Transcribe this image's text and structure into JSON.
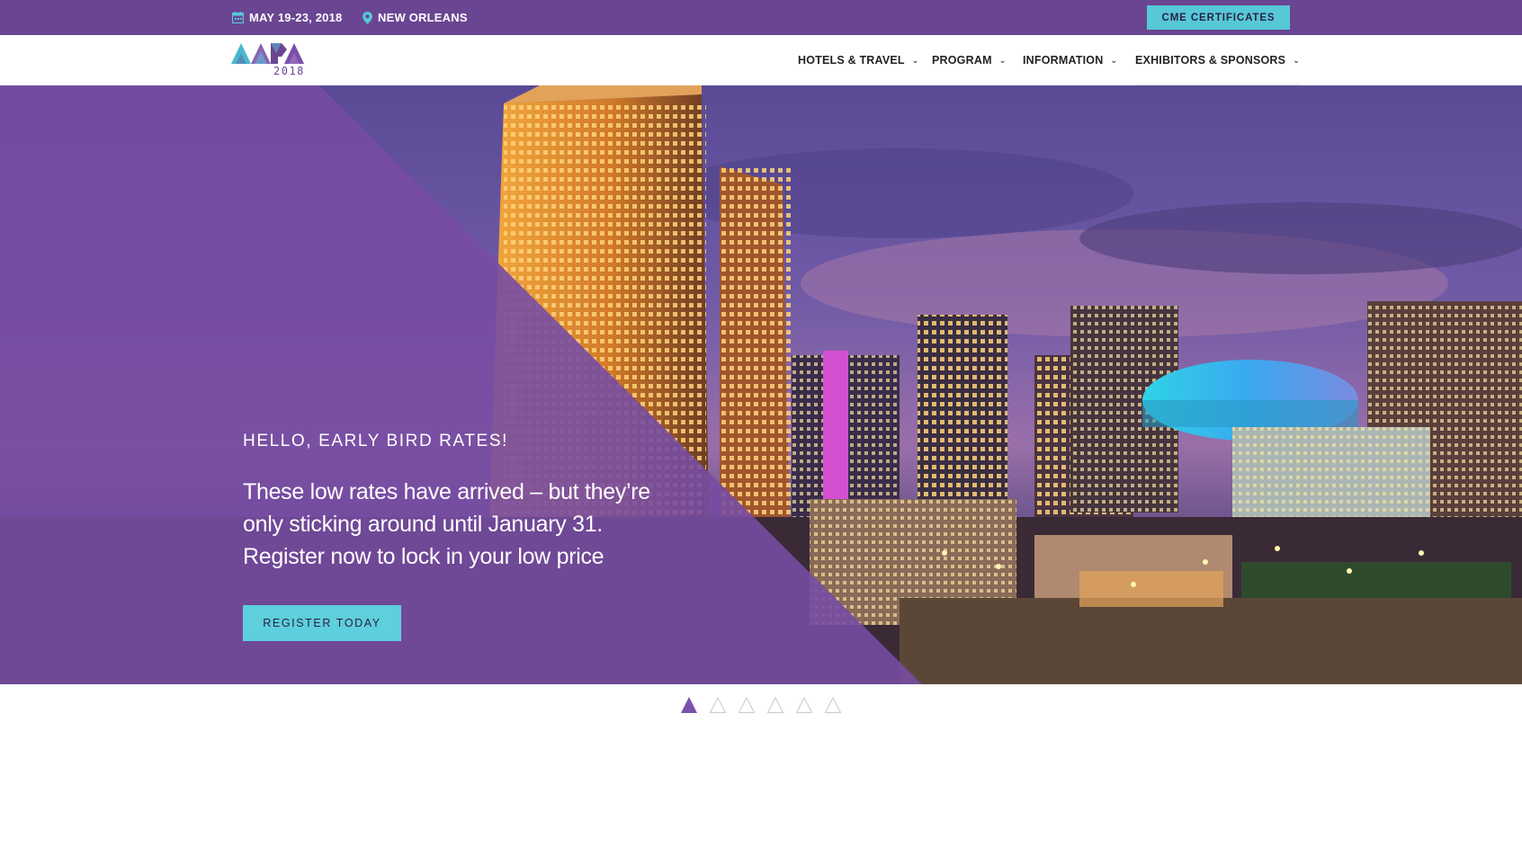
{
  "topbar": {
    "date": "MAY 19-23, 2018",
    "location": "NEW ORLEANS",
    "cme_button": "CME CERTIFICATES",
    "icons": {
      "date": "calendar-icon",
      "location": "map-pin-icon"
    }
  },
  "logo": {
    "letters": "AAPA",
    "year": "2018"
  },
  "nav": {
    "items": [
      {
        "label": "HOTELS & TRAVEL"
      },
      {
        "label": "PROGRAM"
      },
      {
        "label": "INFORMATION"
      },
      {
        "label": "EXHIBITORS & SPONSORS"
      }
    ]
  },
  "hero": {
    "kicker": "HELLO, EARLY BIRD RATES!",
    "text": "These low rates have arrived – but they’re only sticking around until January 31. Register now to lock in your low price",
    "button": "REGISTER TODAY"
  },
  "slider": {
    "count": 6,
    "active": 1
  },
  "colors": {
    "purple": "#6a4592",
    "teal": "#56c8d6",
    "dark": "#2b1f45"
  }
}
